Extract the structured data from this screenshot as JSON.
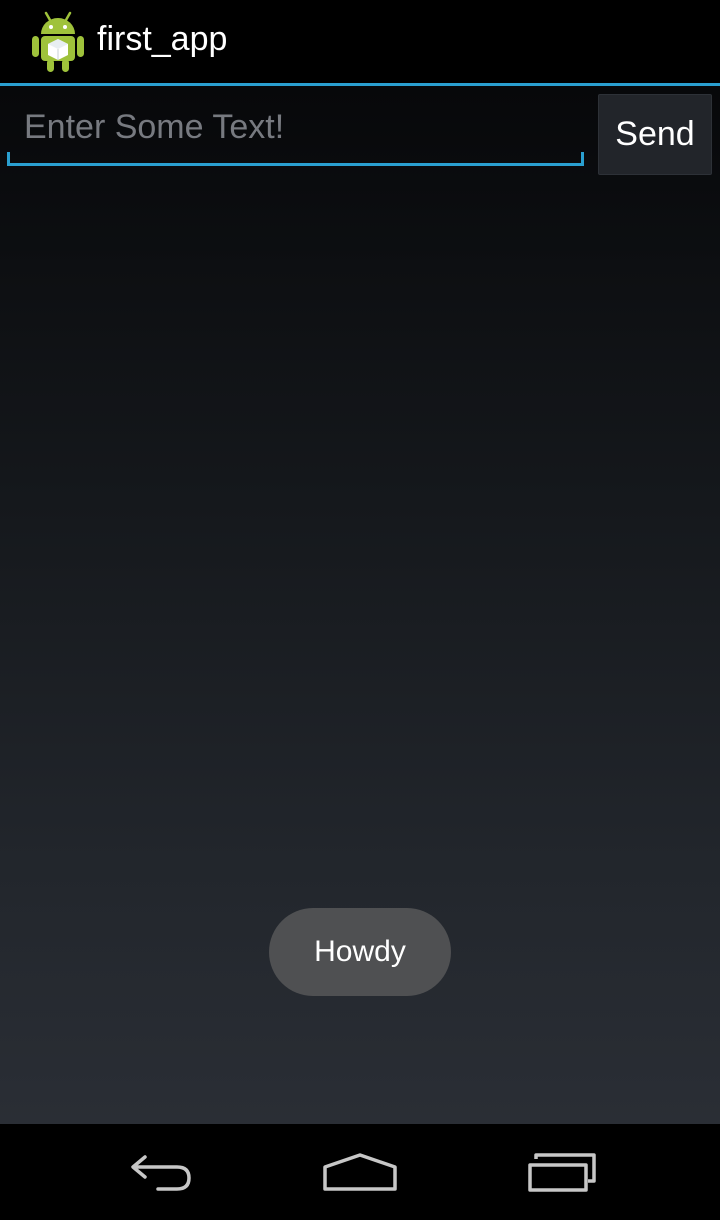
{
  "app": {
    "title": "first_app",
    "icon": "android-robot-icon"
  },
  "form": {
    "input_placeholder": "Enter Some Text!",
    "input_value": "",
    "send_label": "Send"
  },
  "toast": {
    "message": "Howdy"
  },
  "nav": {
    "items": [
      "back-icon",
      "home-icon",
      "recent-apps-icon"
    ]
  },
  "colors": {
    "accent": "#2a9fd0",
    "toast_bg": "#4f5052",
    "android_green": "#9fc23b"
  }
}
